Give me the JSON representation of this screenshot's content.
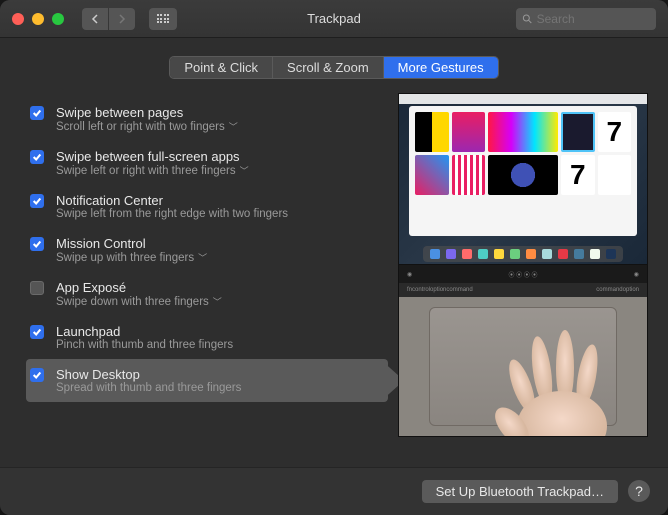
{
  "window": {
    "title": "Trackpad"
  },
  "search": {
    "placeholder": "Search"
  },
  "tabs": [
    {
      "label": "Point & Click",
      "active": false
    },
    {
      "label": "Scroll & Zoom",
      "active": false
    },
    {
      "label": "More Gestures",
      "active": true
    }
  ],
  "gestures": [
    {
      "title": "Swipe between pages",
      "sub": "Scroll left or right with two fingers",
      "checked": true,
      "dropdown": true,
      "selected": false
    },
    {
      "title": "Swipe between full-screen apps",
      "sub": "Swipe left or right with three fingers",
      "checked": true,
      "dropdown": true,
      "selected": false
    },
    {
      "title": "Notification Center",
      "sub": "Swipe left from the right edge with two fingers",
      "checked": true,
      "dropdown": false,
      "selected": false
    },
    {
      "title": "Mission Control",
      "sub": "Swipe up with three fingers",
      "checked": true,
      "dropdown": true,
      "selected": false
    },
    {
      "title": "App Exposé",
      "sub": "Swipe down with three fingers",
      "checked": false,
      "dropdown": true,
      "selected": false
    },
    {
      "title": "Launchpad",
      "sub": "Pinch with thumb and three fingers",
      "checked": true,
      "dropdown": false,
      "selected": false
    },
    {
      "title": "Show Desktop",
      "sub": "Spread with thumb and three fingers",
      "checked": true,
      "dropdown": false,
      "selected": true
    }
  ],
  "touchbar_keys": {
    "left": [
      "fn",
      "control",
      "option",
      "command"
    ],
    "right": [
      "command",
      "option"
    ]
  },
  "footer": {
    "bluetooth": "Set Up Bluetooth Trackpad…",
    "help": "?"
  }
}
